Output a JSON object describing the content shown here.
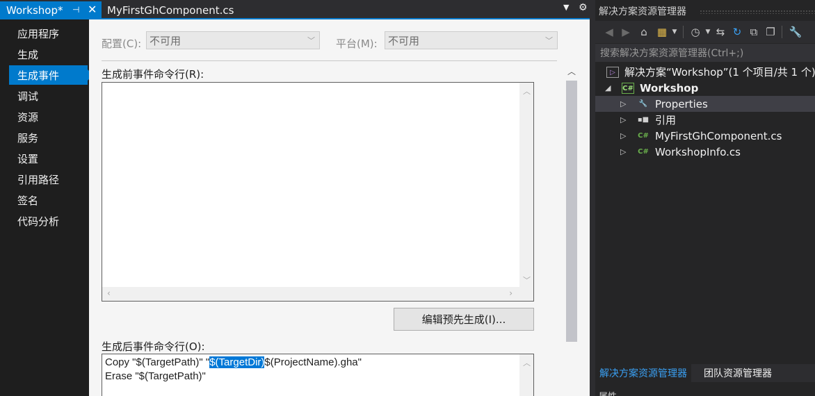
{
  "document": {
    "tabs": [
      {
        "label": "Workshop*",
        "pin": "⊣",
        "close": "✕"
      },
      {
        "label": "MyFirstGhComponent.cs"
      }
    ],
    "nav": [
      {
        "label": "应用程序"
      },
      {
        "label": "生成"
      },
      {
        "label": "生成事件",
        "selected": true
      },
      {
        "label": "调试"
      },
      {
        "label": "资源"
      },
      {
        "label": "服务"
      },
      {
        "label": "设置"
      },
      {
        "label": "引用路径"
      },
      {
        "label": "签名"
      },
      {
        "label": "代码分析"
      }
    ],
    "config": {
      "config_label": "配置(C):",
      "config_value": "不可用",
      "platform_label": "平台(M):",
      "platform_value": "不可用"
    },
    "prebuild": {
      "label": "生成前事件命令行(R):",
      "value": ""
    },
    "edit_prebuild_button": "编辑预先生成(I)...",
    "postbuild": {
      "label": "生成后事件命令行(O):",
      "line1_before": "Copy \"$(TargetPath)\" \"",
      "line1_selected": "$(TargetDir)",
      "line1_after": "$(ProjectName).gha\"",
      "line2": "Erase \"$(TargetPath)\""
    }
  },
  "solution_explorer": {
    "title": "解决方案资源管理器",
    "search_placeholder": "搜索解决方案资源管理器(Ctrl+;)",
    "toolbar_icons": [
      "back-icon",
      "forward-icon",
      "home-icon",
      "switch-views-icon",
      "history-icon",
      "sync-icon",
      "refresh-icon",
      "collapse-all-icon",
      "show-all-files-icon",
      "properties-wrench-icon"
    ],
    "tree": {
      "solution": "解决方案“Workshop”(1 个项目/共 1 个)",
      "project": "Workshop",
      "items": [
        {
          "label": "Properties",
          "icon": "wrench-icon"
        },
        {
          "label": "引用",
          "icon": "references-icon"
        },
        {
          "label": "MyFirstGhComponent.cs",
          "icon": "csharp-file-icon"
        },
        {
          "label": "WorkshopInfo.cs",
          "icon": "csharp-file-icon"
        }
      ]
    },
    "bottom_tabs": [
      {
        "label": "解决方案资源管理器",
        "active": true
      },
      {
        "label": "团队资源管理器"
      }
    ],
    "next_panel_title": "属性"
  },
  "colors": {
    "accent": "#007acc",
    "dark_bg": "#2d2d30",
    "nav_bg": "#1e1e1e",
    "page_bg": "#f5f5f5",
    "tree_bg": "#252526",
    "selection": "#0078d7"
  }
}
